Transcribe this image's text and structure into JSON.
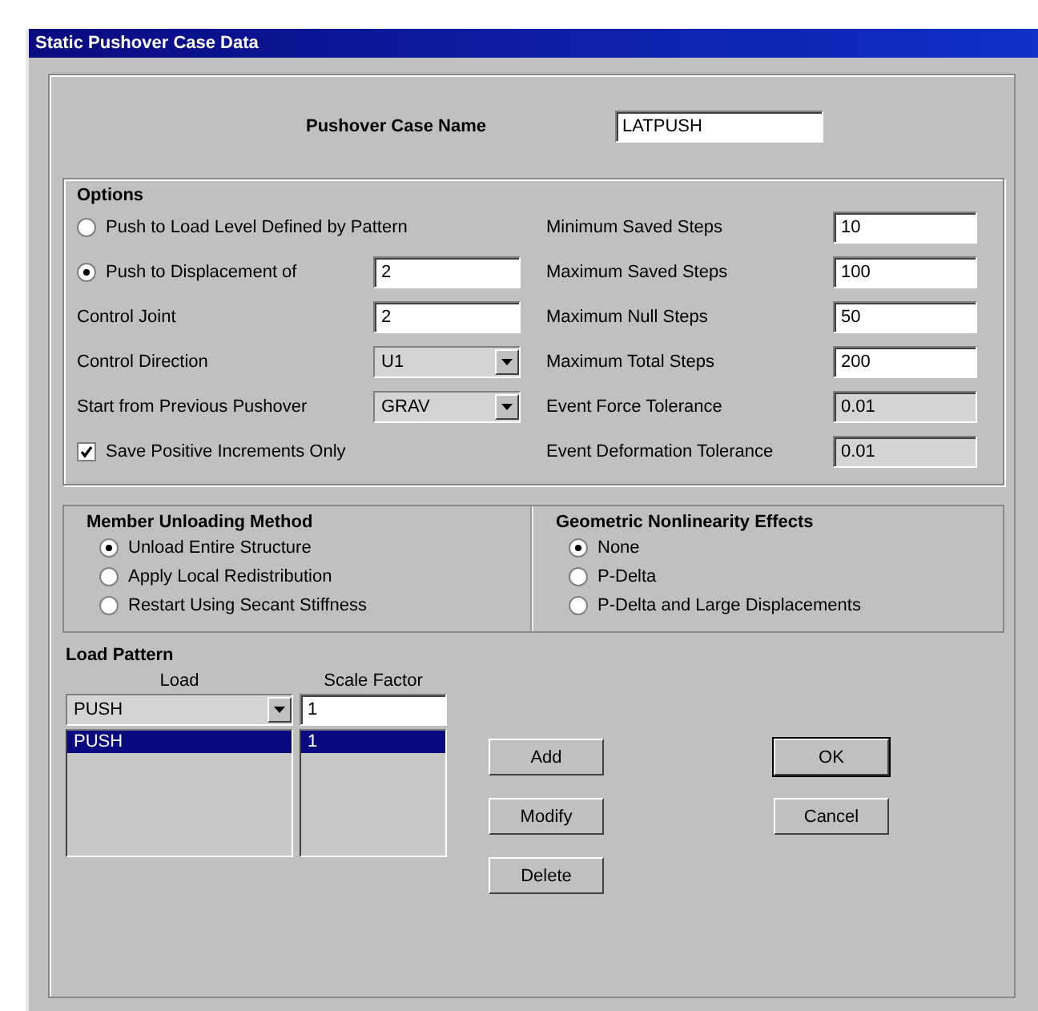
{
  "window": {
    "title": "Static Pushover Case Data"
  },
  "case_name": {
    "label": "Pushover Case Name",
    "value": "LATPUSH"
  },
  "options": {
    "title": "Options",
    "left": [
      {
        "kind": "radio",
        "label": "Push to Load Level Defined by Pattern",
        "selected": false
      },
      {
        "kind": "radio",
        "label": "Push to Displacement of",
        "selected": true,
        "value": "2"
      },
      {
        "kind": "field",
        "label": "Control Joint",
        "value": "2"
      },
      {
        "kind": "dropdown",
        "label": "Control Direction",
        "value": "U1"
      },
      {
        "kind": "dropdown",
        "label": "Start from Previous Pushover",
        "value": "GRAV"
      },
      {
        "kind": "checkbox",
        "label": "Save Positive Increments Only",
        "checked": true
      }
    ],
    "right": [
      {
        "label": "Minimum Saved Steps",
        "value": "10",
        "disabled": false
      },
      {
        "label": "Maximum Saved Steps",
        "value": "100",
        "disabled": false
      },
      {
        "label": "Maximum Null Steps",
        "value": "50",
        "disabled": false
      },
      {
        "label": "Maximum Total Steps",
        "value": "200",
        "disabled": false
      },
      {
        "label": "Event Force Tolerance",
        "value": "0.01",
        "disabled": true
      },
      {
        "label": "Event Deformation Tolerance",
        "value": "0.01",
        "disabled": true
      }
    ]
  },
  "member_unloading": {
    "title": "Member Unloading Method",
    "options": [
      {
        "label": "Unload Entire Structure",
        "selected": true
      },
      {
        "label": "Apply Local Redistribution",
        "selected": false
      },
      {
        "label": "Restart Using Secant Stiffness",
        "selected": false
      }
    ]
  },
  "geometric_nonlinearity": {
    "title": "Geometric Nonlinearity Effects",
    "options": [
      {
        "label": "None",
        "selected": true
      },
      {
        "label": "P-Delta",
        "selected": false
      },
      {
        "label": "P-Delta and Large Displacements",
        "selected": false
      }
    ]
  },
  "load_pattern": {
    "title": "Load Pattern",
    "load_header": "Load",
    "scale_header": "Scale Factor",
    "load_value": "PUSH",
    "scale_value": "1",
    "rows": [
      {
        "load": "PUSH",
        "scale": "1",
        "selected": true
      }
    ]
  },
  "edit_buttons": [
    "Add",
    "Modify",
    "Delete"
  ],
  "dialog_buttons": [
    {
      "label": "OK",
      "default": true
    },
    {
      "label": "Cancel",
      "default": false
    }
  ]
}
